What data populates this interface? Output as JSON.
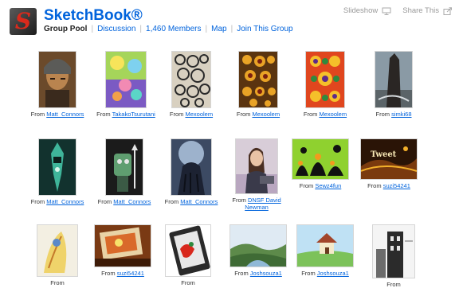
{
  "header": {
    "title": "SketchBook®",
    "nav": {
      "current": "Group Pool",
      "links": [
        "Discussion",
        "1,460 Members",
        "Map",
        "Join This Group"
      ]
    },
    "tools": {
      "slideshow": "Slideshow",
      "share": "Share This"
    }
  },
  "pool": {
    "from_label": "From",
    "rows": [
      [
        {
          "user": "Matt_Connors"
        },
        {
          "user": "TakakoTsurutani"
        },
        {
          "user": "Mexoolem"
        },
        {
          "user": "Mexoolem"
        },
        {
          "user": "Mexoolem"
        },
        {
          "user": "simki68"
        }
      ],
      [
        {
          "user": "Matt_Connors"
        },
        {
          "user": "Matt_Connors"
        },
        {
          "user": "Matt_Connors"
        },
        {
          "user": "DNSF David Newman"
        },
        {
          "user": "Sewz4fun"
        },
        {
          "user": "suzi54241"
        }
      ],
      [
        {
          "user": ""
        },
        {
          "user": "suzi54241"
        },
        {
          "user": ""
        },
        {
          "user": "Joshsouza1"
        },
        {
          "user": "Joshsouza1"
        },
        {
          "user": ""
        }
      ]
    ],
    "tweet_art_text": "Tweet"
  },
  "colors": {
    "link": "#0063dc",
    "logo_red": "#d92a1c"
  }
}
